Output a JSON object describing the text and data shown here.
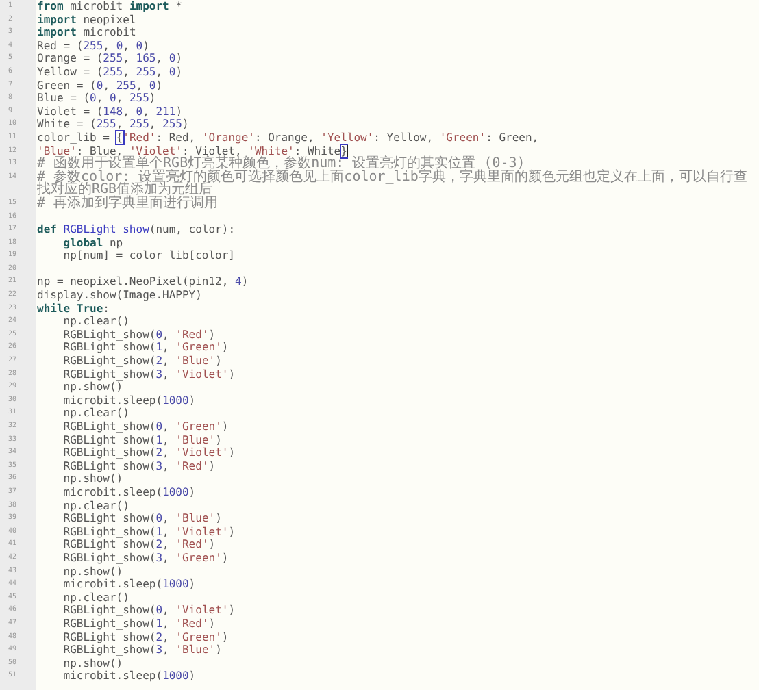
{
  "editor": {
    "lines": [
      {
        "number": "1",
        "tokens": [
          {
            "kind": "keyword",
            "text": "from"
          },
          {
            "kind": "plain",
            "text": " microbit "
          },
          {
            "kind": "keyword",
            "text": "import"
          },
          {
            "kind": "plain",
            "text": " *"
          }
        ]
      },
      {
        "number": "2",
        "tokens": [
          {
            "kind": "keyword",
            "text": "import"
          },
          {
            "kind": "plain",
            "text": " neopixel"
          }
        ]
      },
      {
        "number": "3",
        "tokens": [
          {
            "kind": "keyword",
            "text": "import"
          },
          {
            "kind": "plain",
            "text": " microbit"
          }
        ]
      },
      {
        "number": "4",
        "tokens": [
          {
            "kind": "plain",
            "text": "Red = ("
          },
          {
            "kind": "number",
            "text": "255"
          },
          {
            "kind": "plain",
            "text": ", "
          },
          {
            "kind": "number",
            "text": "0"
          },
          {
            "kind": "plain",
            "text": ", "
          },
          {
            "kind": "number",
            "text": "0"
          },
          {
            "kind": "plain",
            "text": ")"
          }
        ]
      },
      {
        "number": "5",
        "tokens": [
          {
            "kind": "plain",
            "text": "Orange = ("
          },
          {
            "kind": "number",
            "text": "255"
          },
          {
            "kind": "plain",
            "text": ", "
          },
          {
            "kind": "number",
            "text": "165"
          },
          {
            "kind": "plain",
            "text": ", "
          },
          {
            "kind": "number",
            "text": "0"
          },
          {
            "kind": "plain",
            "text": ")"
          }
        ]
      },
      {
        "number": "6",
        "tokens": [
          {
            "kind": "plain",
            "text": "Yellow = ("
          },
          {
            "kind": "number",
            "text": "255"
          },
          {
            "kind": "plain",
            "text": ", "
          },
          {
            "kind": "number",
            "text": "255"
          },
          {
            "kind": "plain",
            "text": ", "
          },
          {
            "kind": "number",
            "text": "0"
          },
          {
            "kind": "plain",
            "text": ")"
          }
        ]
      },
      {
        "number": "7",
        "tokens": [
          {
            "kind": "plain",
            "text": "Green = ("
          },
          {
            "kind": "number",
            "text": "0"
          },
          {
            "kind": "plain",
            "text": ", "
          },
          {
            "kind": "number",
            "text": "255"
          },
          {
            "kind": "plain",
            "text": ", "
          },
          {
            "kind": "number",
            "text": "0"
          },
          {
            "kind": "plain",
            "text": ")"
          }
        ]
      },
      {
        "number": "8",
        "tokens": [
          {
            "kind": "plain",
            "text": "Blue = ("
          },
          {
            "kind": "number",
            "text": "0"
          },
          {
            "kind": "plain",
            "text": ", "
          },
          {
            "kind": "number",
            "text": "0"
          },
          {
            "kind": "plain",
            "text": ", "
          },
          {
            "kind": "number",
            "text": "255"
          },
          {
            "kind": "plain",
            "text": ")"
          }
        ]
      },
      {
        "number": "9",
        "tokens": [
          {
            "kind": "plain",
            "text": "Violet = ("
          },
          {
            "kind": "number",
            "text": "148"
          },
          {
            "kind": "plain",
            "text": ", "
          },
          {
            "kind": "number",
            "text": "0"
          },
          {
            "kind": "plain",
            "text": ", "
          },
          {
            "kind": "number",
            "text": "211"
          },
          {
            "kind": "plain",
            "text": ")"
          }
        ]
      },
      {
        "number": "10",
        "tokens": [
          {
            "kind": "plain",
            "text": "White = ("
          },
          {
            "kind": "number",
            "text": "255"
          },
          {
            "kind": "plain",
            "text": ", "
          },
          {
            "kind": "number",
            "text": "255"
          },
          {
            "kind": "plain",
            "text": ", "
          },
          {
            "kind": "number",
            "text": "255"
          },
          {
            "kind": "plain",
            "text": ")"
          }
        ]
      },
      {
        "number": "11",
        "tokens": [
          {
            "kind": "plain",
            "text": "color_lib = "
          },
          {
            "kind": "bracket",
            "text": "{"
          },
          {
            "kind": "string",
            "text": "'Red'"
          },
          {
            "kind": "plain",
            "text": ": Red, "
          },
          {
            "kind": "string",
            "text": "'Orange'"
          },
          {
            "kind": "plain",
            "text": ": Orange, "
          },
          {
            "kind": "string",
            "text": "'Yellow'"
          },
          {
            "kind": "plain",
            "text": ": Yellow, "
          },
          {
            "kind": "string",
            "text": "'Green'"
          },
          {
            "kind": "plain",
            "text": ": Green,"
          }
        ]
      },
      {
        "number": "12",
        "cursor": true,
        "tokens": [
          {
            "kind": "string",
            "text": "'Blue'"
          },
          {
            "kind": "plain",
            "text": ": Blue, "
          },
          {
            "kind": "string",
            "text": "'Violet'"
          },
          {
            "kind": "plain",
            "text": ": Violet, "
          },
          {
            "kind": "string",
            "text": "'White'"
          },
          {
            "kind": "plain",
            "text": ": White"
          },
          {
            "kind": "bracket",
            "text": "}"
          }
        ]
      },
      {
        "number": "13",
        "tokens": [
          {
            "kind": "comment",
            "text": "# 函数用于设置单个RGB灯亮某种颜色，参数num: 设置亮灯的其实位置 (0-3)"
          }
        ]
      },
      {
        "number": "14",
        "tokens": [
          {
            "kind": "comment",
            "text": "# 参数color: 设置亮灯的颜色可选择颜色见上面color_lib字典，字典里面的颜色元组也定义在上面，可以自行查找对应的RGB值添加为元组后"
          }
        ]
      },
      {
        "number": "15",
        "tokens": [
          {
            "kind": "comment",
            "text": "# 再添加到字典里面进行调用"
          }
        ]
      },
      {
        "number": "16"
      },
      {
        "number": "17",
        "tokens": [
          {
            "kind": "keyword",
            "text": "def"
          },
          {
            "kind": "function",
            "text": " RGBLight_show"
          },
          {
            "kind": "plain",
            "text": "(num, color):"
          }
        ]
      },
      {
        "number": "18",
        "tokens": [
          {
            "kind": "keyword",
            "text": "    global"
          },
          {
            "kind": "plain",
            "text": " np"
          }
        ]
      },
      {
        "number": "19",
        "tokens": [
          {
            "kind": "plain",
            "text": "    np[num] = color_lib[color]"
          }
        ]
      },
      {
        "number": "20"
      },
      {
        "number": "21",
        "tokens": [
          {
            "kind": "plain",
            "text": "np = neopixel.NeoPixel(pin12, "
          },
          {
            "kind": "number",
            "text": "4"
          },
          {
            "kind": "plain",
            "text": ")"
          }
        ]
      },
      {
        "number": "22",
        "tokens": [
          {
            "kind": "plain",
            "text": "display.show(Image.HAPPY)"
          }
        ]
      },
      {
        "number": "23",
        "tokens": [
          {
            "kind": "keyword",
            "text": "while True"
          },
          {
            "kind": "plain",
            "text": ":"
          }
        ]
      },
      {
        "number": "24",
        "tokens": [
          {
            "kind": "plain",
            "text": "    np.clear()"
          }
        ]
      },
      {
        "number": "25",
        "tokens": [
          {
            "kind": "plain",
            "text": "    RGBLight_show("
          },
          {
            "kind": "number",
            "text": "0"
          },
          {
            "kind": "plain",
            "text": ", "
          },
          {
            "kind": "string",
            "text": "'Red'"
          },
          {
            "kind": "plain",
            "text": ")"
          }
        ]
      },
      {
        "number": "26",
        "tokens": [
          {
            "kind": "plain",
            "text": "    RGBLight_show("
          },
          {
            "kind": "number",
            "text": "1"
          },
          {
            "kind": "plain",
            "text": ", "
          },
          {
            "kind": "string",
            "text": "'Green'"
          },
          {
            "kind": "plain",
            "text": ")"
          }
        ]
      },
      {
        "number": "27",
        "tokens": [
          {
            "kind": "plain",
            "text": "    RGBLight_show("
          },
          {
            "kind": "number",
            "text": "2"
          },
          {
            "kind": "plain",
            "text": ", "
          },
          {
            "kind": "string",
            "text": "'Blue'"
          },
          {
            "kind": "plain",
            "text": ")"
          }
        ]
      },
      {
        "number": "28",
        "tokens": [
          {
            "kind": "plain",
            "text": "    RGBLight_show("
          },
          {
            "kind": "number",
            "text": "3"
          },
          {
            "kind": "plain",
            "text": ", "
          },
          {
            "kind": "string",
            "text": "'Violet'"
          },
          {
            "kind": "plain",
            "text": ")"
          }
        ]
      },
      {
        "number": "29",
        "tokens": [
          {
            "kind": "plain",
            "text": "    np.show()"
          }
        ]
      },
      {
        "number": "30",
        "tokens": [
          {
            "kind": "plain",
            "text": "    microbit.sleep("
          },
          {
            "kind": "number",
            "text": "1000"
          },
          {
            "kind": "plain",
            "text": ")"
          }
        ]
      },
      {
        "number": "31",
        "tokens": [
          {
            "kind": "plain",
            "text": "    np.clear()"
          }
        ]
      },
      {
        "number": "32",
        "tokens": [
          {
            "kind": "plain",
            "text": "    RGBLight_show("
          },
          {
            "kind": "number",
            "text": "0"
          },
          {
            "kind": "plain",
            "text": ", "
          },
          {
            "kind": "string",
            "text": "'Green'"
          },
          {
            "kind": "plain",
            "text": ")"
          }
        ]
      },
      {
        "number": "33",
        "tokens": [
          {
            "kind": "plain",
            "text": "    RGBLight_show("
          },
          {
            "kind": "number",
            "text": "1"
          },
          {
            "kind": "plain",
            "text": ", "
          },
          {
            "kind": "string",
            "text": "'Blue'"
          },
          {
            "kind": "plain",
            "text": ")"
          }
        ]
      },
      {
        "number": "34",
        "tokens": [
          {
            "kind": "plain",
            "text": "    RGBLight_show("
          },
          {
            "kind": "number",
            "text": "2"
          },
          {
            "kind": "plain",
            "text": ", "
          },
          {
            "kind": "string",
            "text": "'Violet'"
          },
          {
            "kind": "plain",
            "text": ")"
          }
        ]
      },
      {
        "number": "35",
        "tokens": [
          {
            "kind": "plain",
            "text": "    RGBLight_show("
          },
          {
            "kind": "number",
            "text": "3"
          },
          {
            "kind": "plain",
            "text": ", "
          },
          {
            "kind": "string",
            "text": "'Red'"
          },
          {
            "kind": "plain",
            "text": ")"
          }
        ]
      },
      {
        "number": "36",
        "tokens": [
          {
            "kind": "plain",
            "text": "    np.show()"
          }
        ]
      },
      {
        "number": "37",
        "tokens": [
          {
            "kind": "plain",
            "text": "    microbit.sleep("
          },
          {
            "kind": "number",
            "text": "1000"
          },
          {
            "kind": "plain",
            "text": ")"
          }
        ]
      },
      {
        "number": "38",
        "tokens": [
          {
            "kind": "plain",
            "text": "    np.clear()"
          }
        ]
      },
      {
        "number": "39",
        "tokens": [
          {
            "kind": "plain",
            "text": "    RGBLight_show("
          },
          {
            "kind": "number",
            "text": "0"
          },
          {
            "kind": "plain",
            "text": ", "
          },
          {
            "kind": "string",
            "text": "'Blue'"
          },
          {
            "kind": "plain",
            "text": ")"
          }
        ]
      },
      {
        "number": "40",
        "tokens": [
          {
            "kind": "plain",
            "text": "    RGBLight_show("
          },
          {
            "kind": "number",
            "text": "1"
          },
          {
            "kind": "plain",
            "text": ", "
          },
          {
            "kind": "string",
            "text": "'Violet'"
          },
          {
            "kind": "plain",
            "text": ")"
          }
        ]
      },
      {
        "number": "41",
        "tokens": [
          {
            "kind": "plain",
            "text": "    RGBLight_show("
          },
          {
            "kind": "number",
            "text": "2"
          },
          {
            "kind": "plain",
            "text": ", "
          },
          {
            "kind": "string",
            "text": "'Red'"
          },
          {
            "kind": "plain",
            "text": ")"
          }
        ]
      },
      {
        "number": "42",
        "tokens": [
          {
            "kind": "plain",
            "text": "    RGBLight_show("
          },
          {
            "kind": "number",
            "text": "3"
          },
          {
            "kind": "plain",
            "text": ", "
          },
          {
            "kind": "string",
            "text": "'Green'"
          },
          {
            "kind": "plain",
            "text": ")"
          }
        ]
      },
      {
        "number": "43",
        "tokens": [
          {
            "kind": "plain",
            "text": "    np.show()"
          }
        ]
      },
      {
        "number": "44",
        "tokens": [
          {
            "kind": "plain",
            "text": "    microbit.sleep("
          },
          {
            "kind": "number",
            "text": "1000"
          },
          {
            "kind": "plain",
            "text": ")"
          }
        ]
      },
      {
        "number": "45",
        "tokens": [
          {
            "kind": "plain",
            "text": "    np.clear()"
          }
        ]
      },
      {
        "number": "46",
        "tokens": [
          {
            "kind": "plain",
            "text": "    RGBLight_show("
          },
          {
            "kind": "number",
            "text": "0"
          },
          {
            "kind": "plain",
            "text": ", "
          },
          {
            "kind": "string",
            "text": "'Violet'"
          },
          {
            "kind": "plain",
            "text": ")"
          }
        ]
      },
      {
        "number": "47",
        "tokens": [
          {
            "kind": "plain",
            "text": "    RGBLight_show("
          },
          {
            "kind": "number",
            "text": "1"
          },
          {
            "kind": "plain",
            "text": ", "
          },
          {
            "kind": "string",
            "text": "'Red'"
          },
          {
            "kind": "plain",
            "text": ")"
          }
        ]
      },
      {
        "number": "48",
        "tokens": [
          {
            "kind": "plain",
            "text": "    RGBLight_show("
          },
          {
            "kind": "number",
            "text": "2"
          },
          {
            "kind": "plain",
            "text": ", "
          },
          {
            "kind": "string",
            "text": "'Green'"
          },
          {
            "kind": "plain",
            "text": ")"
          }
        ]
      },
      {
        "number": "49",
        "tokens": [
          {
            "kind": "plain",
            "text": "    RGBLight_show("
          },
          {
            "kind": "number",
            "text": "3"
          },
          {
            "kind": "plain",
            "text": ", "
          },
          {
            "kind": "string",
            "text": "'Blue'"
          },
          {
            "kind": "plain",
            "text": ")"
          }
        ]
      },
      {
        "number": "50",
        "tokens": [
          {
            "kind": "plain",
            "text": "    np.show()"
          }
        ]
      },
      {
        "number": "51",
        "tokens": [
          {
            "kind": "plain",
            "text": "    microbit.sleep("
          },
          {
            "kind": "number",
            "text": "1000"
          },
          {
            "kind": "plain",
            "text": ")"
          }
        ]
      }
    ]
  }
}
